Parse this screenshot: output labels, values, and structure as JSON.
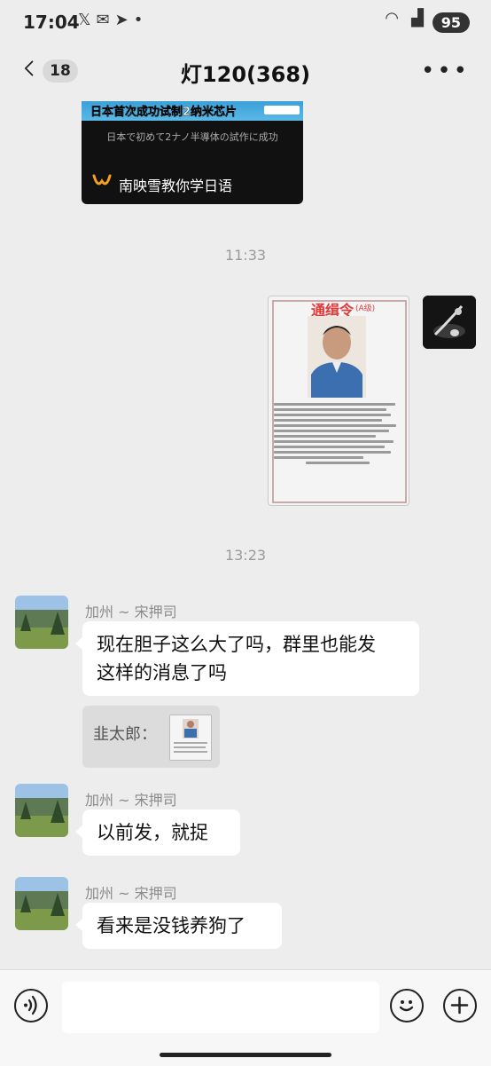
{
  "status_bar": {
    "time": "17:04",
    "icons": [
      "x-icon",
      "gmail-icon",
      "telegram-icon",
      "dot-icon"
    ],
    "battery": "95"
  },
  "header": {
    "unread_count": "18",
    "title": "灯120(368)"
  },
  "video_card": {
    "banner_text": "日本首次成功试制2纳米芯片",
    "caption": "日本で初めて2ナノ半導体の試作に成功",
    "source": "南映雪教你学日语"
  },
  "timestamps": [
    "11:33",
    "13:23"
  ],
  "poster": {
    "title": "通缉令",
    "level": "(A级)"
  },
  "messages": [
    {
      "sender": "加州 ~ 宋押司",
      "lines": [
        "现在胆子这么大了吗，群里也能发",
        "这样的消息了吗"
      ]
    },
    {
      "sender": "加州 ~ 宋押司",
      "text": "以前发，就捉"
    },
    {
      "sender": "加州 ~ 宋押司",
      "text": "看来是没钱养狗了"
    }
  ],
  "quote": {
    "text": "韭太郎："
  },
  "colors": {
    "background": "#ededed",
    "bubble": "#ffffff",
    "accent_orange": "#f7a01b"
  }
}
